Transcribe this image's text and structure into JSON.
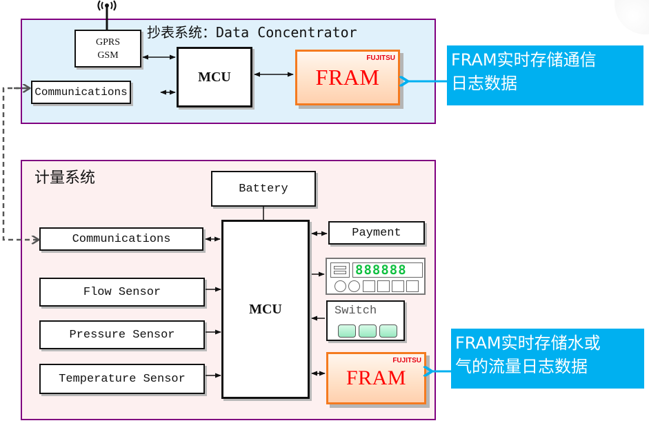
{
  "data_concentrator": {
    "title": "抄表系统：Data Concentrator",
    "gprs_line1": "GPRS",
    "gprs_line2": "GSM",
    "mcu": "MCU",
    "communications": "Communications",
    "fram": "FRAM",
    "fram_brand": "FUJITSU"
  },
  "callout_top": {
    "line1": "FRAM实时存储通信",
    "line2": "日志数据"
  },
  "metering_system": {
    "title": "计量系统",
    "battery": "Battery",
    "communications": "Communications",
    "flow_sensor": "Flow Sensor",
    "pressure_sensor": "Pressure Sensor",
    "temperature_sensor": "Temperature Sensor",
    "mcu": "MCU",
    "payment": "Payment",
    "display_digits": "888888",
    "switch": "Switch",
    "fram": "FRAM",
    "fram_brand": "FUJITSU"
  },
  "callout_bottom": {
    "line1": "FRAM实时存储水或",
    "line2": "气的流量日志数据"
  },
  "colors": {
    "system_border": "#800080",
    "dc_background": "#e0f1fb",
    "meter_background": "#fdf0f0",
    "fram_border": "#f47a1f",
    "fram_text": "#ff0000",
    "callout": "#00b0f0",
    "display_digits": "#10c040"
  }
}
